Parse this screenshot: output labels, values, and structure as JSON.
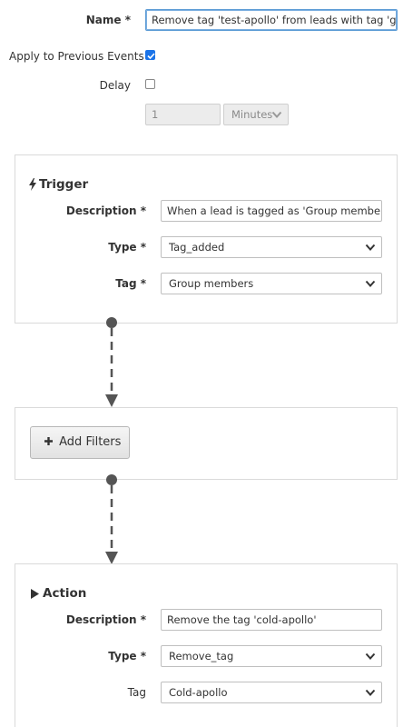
{
  "event": {
    "name_label": "Name *",
    "name_value": "Remove tag 'test-apollo' from leads with tag 'group members'",
    "apply_previous_label": "Apply to Previous Events",
    "apply_previous_checked": true,
    "delay_label": "Delay",
    "delay_checked": false,
    "delay_value": "1",
    "delay_unit": "Minutes"
  },
  "trigger": {
    "title": "Trigger",
    "icon": "bolt-icon",
    "description_label": "Description *",
    "description_value": "When a lead is tagged as 'Group members'",
    "type_label": "Type *",
    "type_value": "Tag_added",
    "tag_label": "Tag *",
    "tag_value": "Group members"
  },
  "filters": {
    "add_button_label": "Add Filters",
    "icon": "plus-icon"
  },
  "action": {
    "title": "Action",
    "icon": "play-icon",
    "description_label": "Description *",
    "description_value": "Remove the tag 'cold-apollo'",
    "type_label": "Type *",
    "type_value": "Remove_tag",
    "tag_label": "Tag",
    "tag_value": "Cold-apollo"
  },
  "colors": {
    "checkbox_checked": "#1a73e8",
    "connector": "#555555"
  }
}
